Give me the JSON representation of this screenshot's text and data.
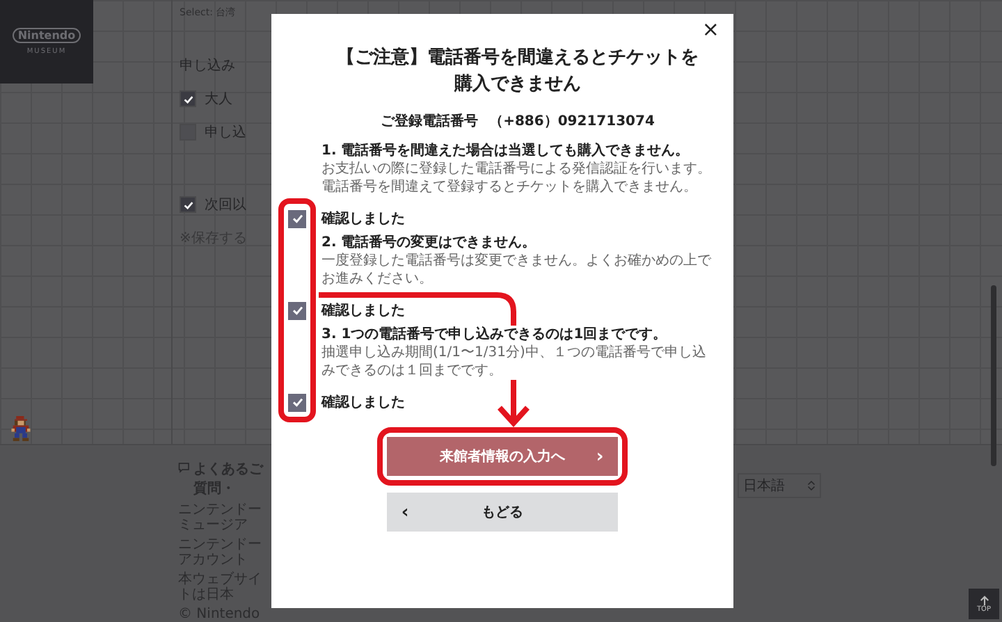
{
  "background": {
    "logo": {
      "wordmark": "Nintendo",
      "subtitle": "MUSEUM"
    },
    "select_label": "Select: 台湾",
    "section_title": "申し込み",
    "options": [
      {
        "label": "大人",
        "checked": true
      },
      {
        "label": "申し込",
        "checked": false
      },
      {
        "label": "次回以",
        "checked": true
      }
    ],
    "note": "※保存する",
    "footer": {
      "faq": "よくあるご質問・",
      "links": [
        "ニンテンドーミュージア",
        "ニンテンドーアカウント"
      ],
      "notice": "本ウェブサイトは日本",
      "copyright": "© Nintendo",
      "language": "日本語",
      "top_button": "TOP"
    }
  },
  "dialog": {
    "close": "×",
    "title": "【ご注意】電話番号を間違えるとチケットを購入できません",
    "phone_label": "ご登録電話番号",
    "phone": "（+886）0921713074",
    "items": [
      {
        "heading": "1. 電話番号を間違えた場合は当選しても購入できません。",
        "body": "お支払いの際に登録した電話番号による発信認証を行います。電話番号を間違えて登録するとチケットを購入できません。",
        "confirm": "確認しました",
        "checked": true
      },
      {
        "heading": "2. 電話番号の変更はできません。",
        "body": "一度登録した電話番号は変更できません。よくお確かめの上でお進みください。",
        "confirm": "確認しました",
        "checked": true
      },
      {
        "heading": "3. 1つの電話番号で申し込みできるのは1回までです。",
        "body": "抽選申し込み期間(1/1〜1/31分)中、１つの電話番号で申し込みできるのは１回までです。",
        "confirm": "確認しました",
        "checked": true
      }
    ],
    "buttons": [
      {
        "label": "来館者情報の入力へ",
        "kind": "primary",
        "chevron": "›"
      },
      {
        "label": "もどる",
        "kind": "secondary",
        "chevron": "‹"
      }
    ]
  }
}
